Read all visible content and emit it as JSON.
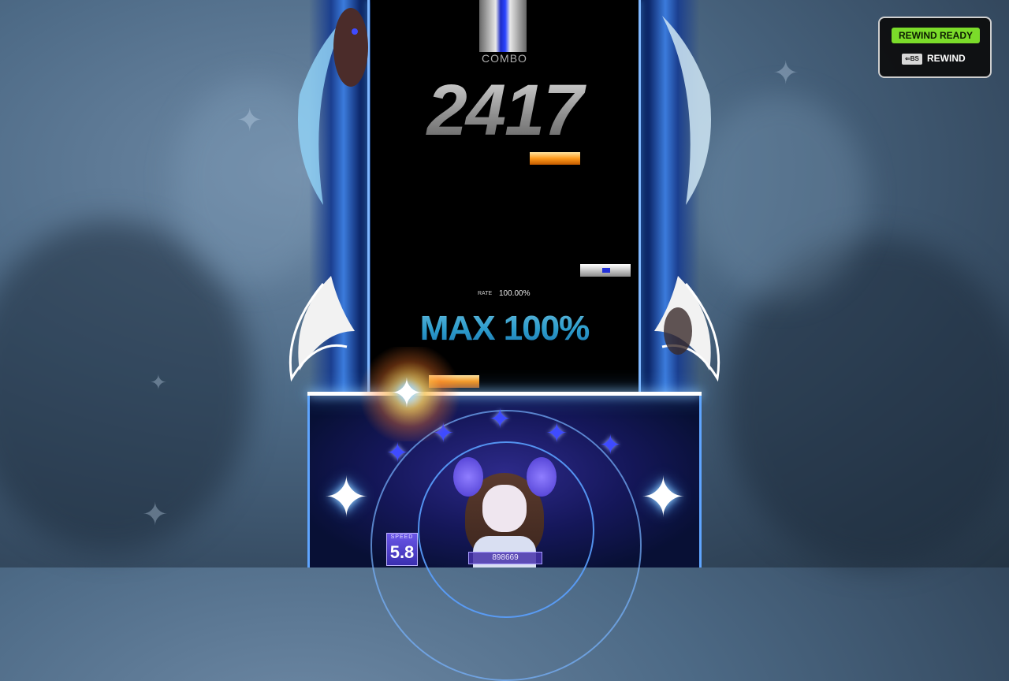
{
  "combo": {
    "label": "COMBO",
    "value": "2417"
  },
  "rate": {
    "label": "RATE",
    "value": "100.00%"
  },
  "judgement": {
    "text": "MAX 100%"
  },
  "speed": {
    "label": "SPEED",
    "value": "5.8"
  },
  "score": {
    "value": "898669"
  },
  "rewind": {
    "status": "REWIND READY",
    "key": "⇐BS",
    "label": "REWIND"
  },
  "colors": {
    "rewind_ready": "#7bdc2a",
    "judgement": "#3ec3e6",
    "note_orange": "#ff9a1a",
    "lane_blue": "#2a44ff"
  }
}
